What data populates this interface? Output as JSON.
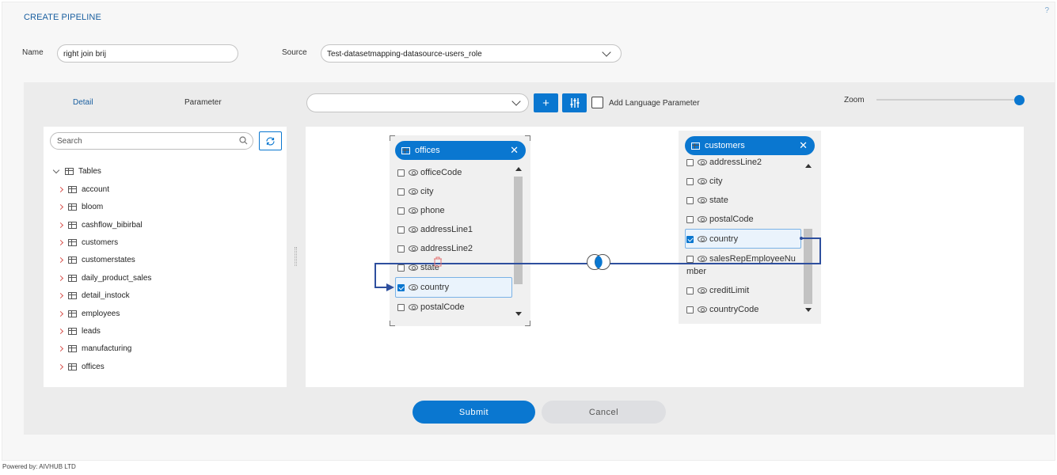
{
  "header": {
    "title": "CREATE PIPELINE",
    "help": "?"
  },
  "form": {
    "name_label": "Name",
    "name_value": "right join brij",
    "source_label": "Source",
    "source_value": "Test-datasetmapping-datasource-users_role"
  },
  "tabs": {
    "detail": "Detail",
    "parameter": "Parameter"
  },
  "toolbar": {
    "join_select_value": "",
    "add_label": "+",
    "add_language_parameter": "Add Language Parameter",
    "zoom_label": "Zoom",
    "zoom_level": 1.0
  },
  "sidebar": {
    "search_placeholder": "Search",
    "tables_label": "Tables",
    "items": [
      "account",
      "bloom",
      "cashflow_bibirbal",
      "customers",
      "customerstates",
      "daily_product_sales",
      "detail_instock",
      "employees",
      "leads",
      "manufacturing",
      "offices"
    ]
  },
  "cards": {
    "offices": {
      "title": "offices",
      "fields": [
        {
          "name": "officeCode",
          "checked": false
        },
        {
          "name": "city",
          "checked": false
        },
        {
          "name": "phone",
          "checked": false
        },
        {
          "name": "addressLine1",
          "checked": false
        },
        {
          "name": "addressLine2",
          "checked": false
        },
        {
          "name": "state",
          "checked": false
        },
        {
          "name": "country",
          "checked": true
        },
        {
          "name": "postalCode",
          "checked": false
        }
      ]
    },
    "customers": {
      "title": "customers",
      "fields": [
        {
          "name": "addressLine2",
          "checked": false
        },
        {
          "name": "city",
          "checked": false
        },
        {
          "name": "state",
          "checked": false
        },
        {
          "name": "postalCode",
          "checked": false
        },
        {
          "name": "country",
          "checked": true
        },
        {
          "name": "salesRepEmployeeNu",
          "checked": false
        },
        {
          "name": "mber",
          "checked": false
        },
        {
          "name": "creditLimit",
          "checked": false
        },
        {
          "name": "countryCode",
          "checked": false
        }
      ]
    }
  },
  "actions": {
    "submit": "Submit",
    "cancel": "Cancel"
  },
  "footer": {
    "powered_by": "Powered by: AIVHUB LTD"
  },
  "colors": {
    "accent": "#0a77d0",
    "title": "#1a5fa0",
    "join_line": "#2e4f9e"
  }
}
